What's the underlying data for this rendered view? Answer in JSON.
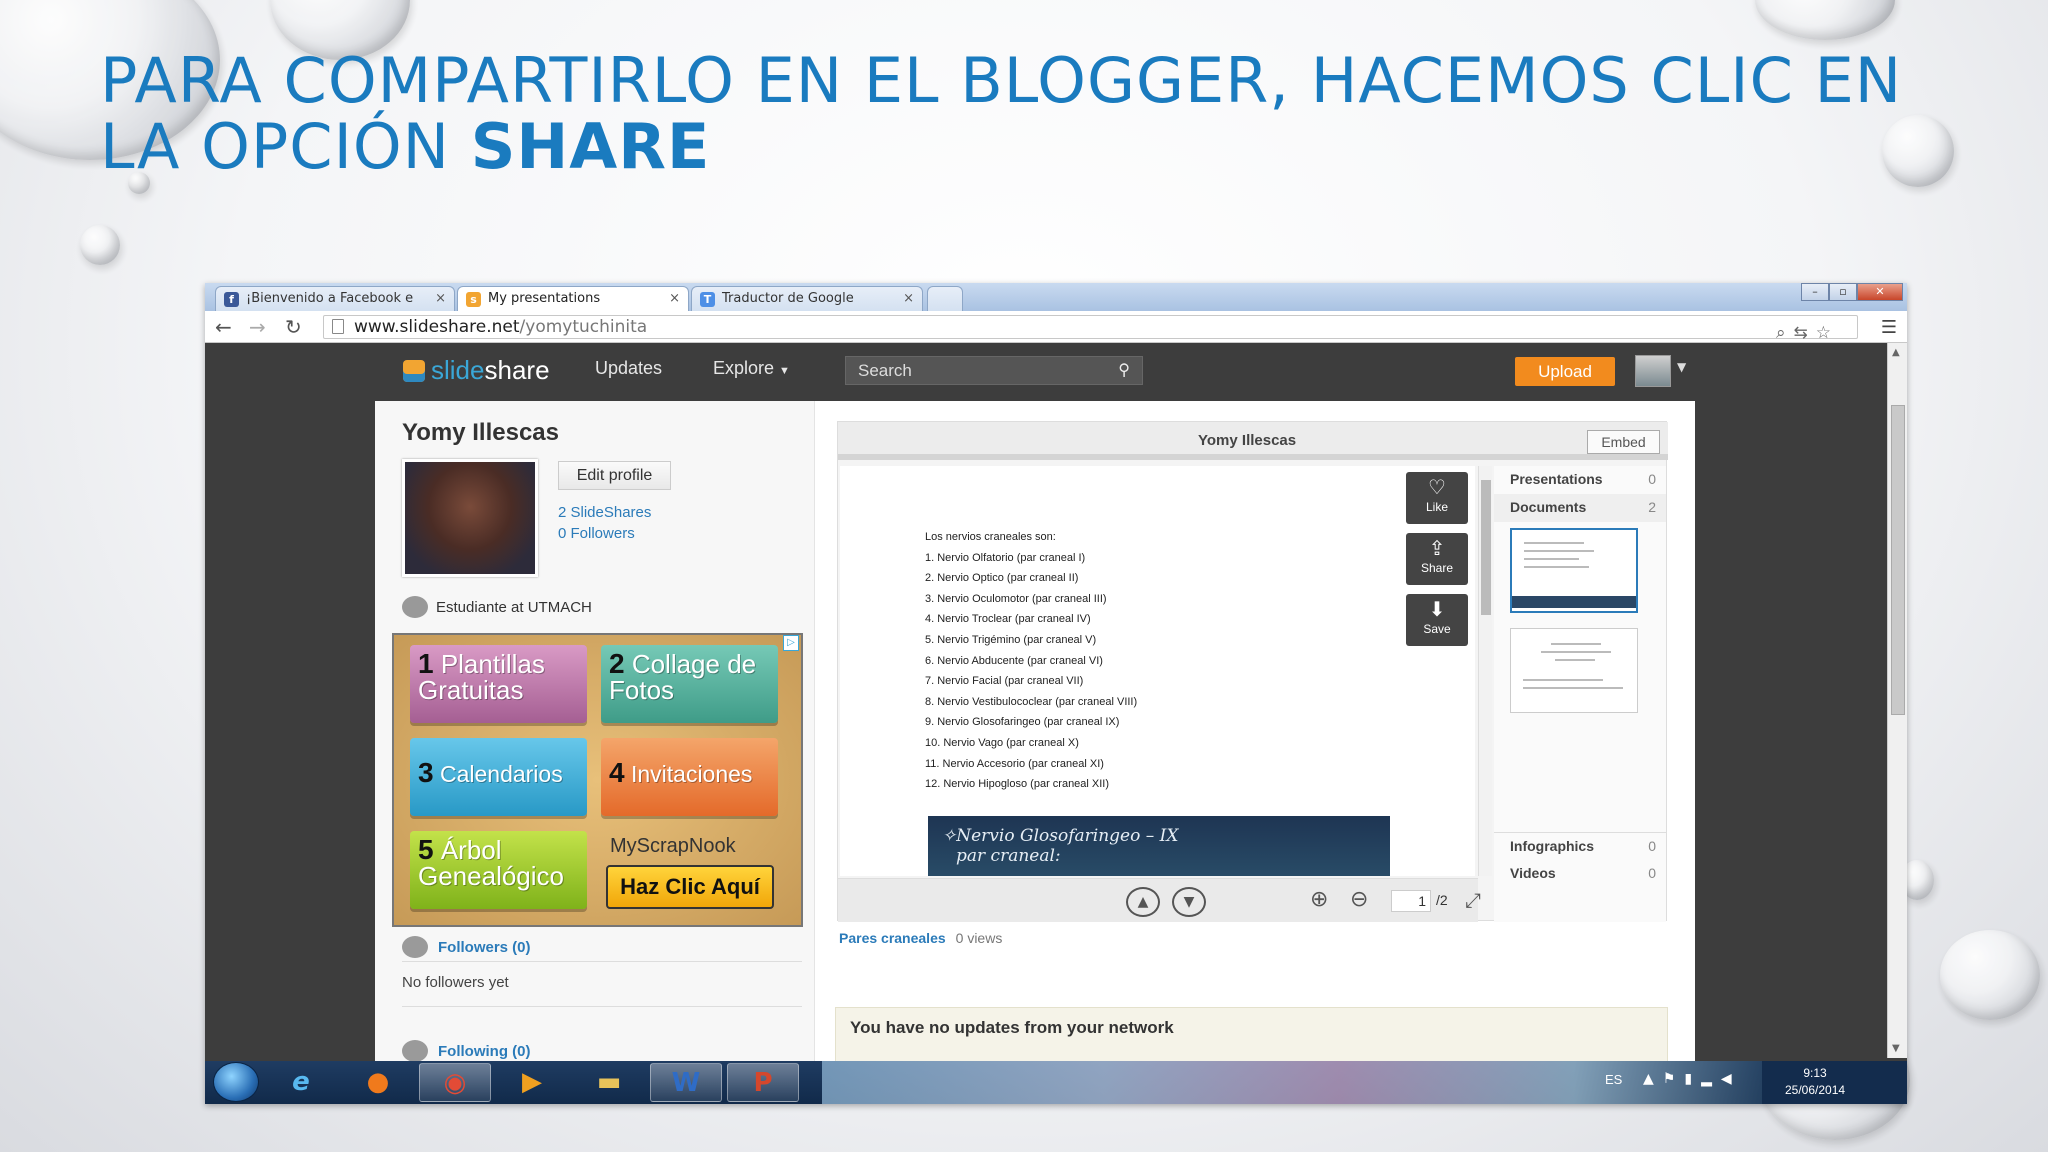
{
  "slide": {
    "title_part1": "PARA COMPARTIRLO EN EL BLOGGER, HACEMOS CLIC EN LA OPCIÓN ",
    "title_bold": "SHARE"
  },
  "browser": {
    "tabs": [
      {
        "label": "¡Bienvenido a Facebook e",
        "icon": "facebook-icon",
        "active": false
      },
      {
        "label": "My presentations",
        "icon": "slideshare-icon",
        "active": true
      },
      {
        "label": "Traductor de Google",
        "icon": "google-translate-icon",
        "active": false
      }
    ],
    "url_host": "www.slideshare.net",
    "url_path": "/yomytuchinita"
  },
  "slideshare": {
    "logo_a": "slide",
    "logo_b": "share",
    "nav": [
      "Updates",
      "Explore"
    ],
    "search_placeholder": "Search",
    "upload_label": "Upload"
  },
  "profile": {
    "name": "Yomy Illescas",
    "edit_label": "Edit profile",
    "slideshares": "2 SlideShares",
    "followers": "0 Followers",
    "occupation": "Estudiante at UTMACH",
    "followers_head": "Followers (0)",
    "no_followers": "No followers yet",
    "following_head": "Following (0)"
  },
  "ad": {
    "tiles": [
      {
        "num": "1",
        "text": "Plantillas Gratuitas"
      },
      {
        "num": "2",
        "text": "Collage de Fotos"
      },
      {
        "num": "3",
        "text": "Calendarios"
      },
      {
        "num": "4",
        "text": "Invitaciones"
      },
      {
        "num": "5",
        "text": "Árbol Genealógico"
      }
    ],
    "brand": "MyScrapNook",
    "cta": "Haz Clic Aquí"
  },
  "viewer": {
    "title": "Yomy Illescas",
    "embed_label": "Embed",
    "actions": [
      {
        "label": "Like",
        "icon": "heart-icon"
      },
      {
        "label": "Share",
        "icon": "share-icon"
      },
      {
        "label": "Save",
        "icon": "download-icon"
      }
    ],
    "doc_heading": "Los nervios craneales son:",
    "doc_lines": [
      "1. Nervio Olfatorio (par craneal I)",
      "2. Nervio Optico (par craneal II)",
      "3. Nervio Oculomotor (par craneal III)",
      "4. Nervio Troclear (par craneal IV)",
      "5. Nervio Trigémino (par craneal V)",
      "6. Nervio Abducente (par craneal VI)",
      "7. Nervio Facial (par craneal VII)",
      "8. Nervio Vestibulococlear (par craneal VIII)",
      "9. Nervio Glosofaringeo (par craneal IX)",
      "10. Nervio Vago (par craneal X)",
      "11. Nervio Accesorio (par craneal XI)",
      "12. Nervio Hipogloso (par craneal XII)"
    ],
    "doc_band_line1": "Nervio Glosofaringeo – IX",
    "doc_band_line2": "par craneal:",
    "side": [
      {
        "label": "Presentations",
        "count": "0"
      },
      {
        "label": "Documents",
        "count": "2"
      },
      {
        "label": "Infographics",
        "count": "0"
      },
      {
        "label": "Videos",
        "count": "0"
      }
    ],
    "page_current": "1",
    "page_total": "/2",
    "doc_name": "Pares craneales",
    "doc_views": "0 views"
  },
  "updates_msg": "You have no updates from your network",
  "taskbar": {
    "lang": "ES",
    "time": "9:13",
    "date": "25/06/2014"
  }
}
